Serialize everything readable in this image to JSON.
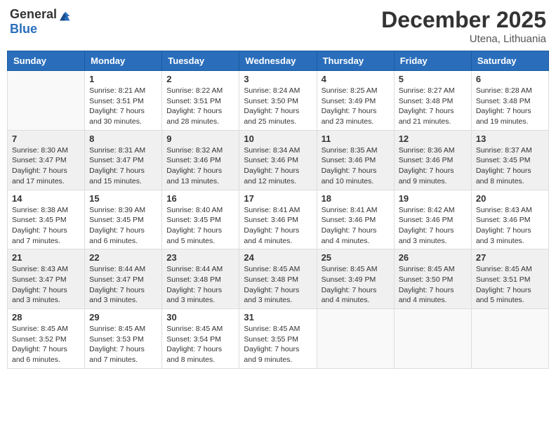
{
  "logo": {
    "general": "General",
    "blue": "Blue"
  },
  "header": {
    "month": "December 2025",
    "location": "Utena, Lithuania"
  },
  "days_of_week": [
    "Sunday",
    "Monday",
    "Tuesday",
    "Wednesday",
    "Thursday",
    "Friday",
    "Saturday"
  ],
  "weeks": [
    {
      "shaded": false,
      "days": [
        {
          "num": "",
          "empty": true
        },
        {
          "num": "1",
          "sunrise": "Sunrise: 8:21 AM",
          "sunset": "Sunset: 3:51 PM",
          "daylight": "Daylight: 7 hours and 30 minutes."
        },
        {
          "num": "2",
          "sunrise": "Sunrise: 8:22 AM",
          "sunset": "Sunset: 3:51 PM",
          "daylight": "Daylight: 7 hours and 28 minutes."
        },
        {
          "num": "3",
          "sunrise": "Sunrise: 8:24 AM",
          "sunset": "Sunset: 3:50 PM",
          "daylight": "Daylight: 7 hours and 25 minutes."
        },
        {
          "num": "4",
          "sunrise": "Sunrise: 8:25 AM",
          "sunset": "Sunset: 3:49 PM",
          "daylight": "Daylight: 7 hours and 23 minutes."
        },
        {
          "num": "5",
          "sunrise": "Sunrise: 8:27 AM",
          "sunset": "Sunset: 3:48 PM",
          "daylight": "Daylight: 7 hours and 21 minutes."
        },
        {
          "num": "6",
          "sunrise": "Sunrise: 8:28 AM",
          "sunset": "Sunset: 3:48 PM",
          "daylight": "Daylight: 7 hours and 19 minutes."
        }
      ]
    },
    {
      "shaded": true,
      "days": [
        {
          "num": "7",
          "sunrise": "Sunrise: 8:30 AM",
          "sunset": "Sunset: 3:47 PM",
          "daylight": "Daylight: 7 hours and 17 minutes."
        },
        {
          "num": "8",
          "sunrise": "Sunrise: 8:31 AM",
          "sunset": "Sunset: 3:47 PM",
          "daylight": "Daylight: 7 hours and 15 minutes."
        },
        {
          "num": "9",
          "sunrise": "Sunrise: 8:32 AM",
          "sunset": "Sunset: 3:46 PM",
          "daylight": "Daylight: 7 hours and 13 minutes."
        },
        {
          "num": "10",
          "sunrise": "Sunrise: 8:34 AM",
          "sunset": "Sunset: 3:46 PM",
          "daylight": "Daylight: 7 hours and 12 minutes."
        },
        {
          "num": "11",
          "sunrise": "Sunrise: 8:35 AM",
          "sunset": "Sunset: 3:46 PM",
          "daylight": "Daylight: 7 hours and 10 minutes."
        },
        {
          "num": "12",
          "sunrise": "Sunrise: 8:36 AM",
          "sunset": "Sunset: 3:46 PM",
          "daylight": "Daylight: 7 hours and 9 minutes."
        },
        {
          "num": "13",
          "sunrise": "Sunrise: 8:37 AM",
          "sunset": "Sunset: 3:45 PM",
          "daylight": "Daylight: 7 hours and 8 minutes."
        }
      ]
    },
    {
      "shaded": false,
      "days": [
        {
          "num": "14",
          "sunrise": "Sunrise: 8:38 AM",
          "sunset": "Sunset: 3:45 PM",
          "daylight": "Daylight: 7 hours and 7 minutes."
        },
        {
          "num": "15",
          "sunrise": "Sunrise: 8:39 AM",
          "sunset": "Sunset: 3:45 PM",
          "daylight": "Daylight: 7 hours and 6 minutes."
        },
        {
          "num": "16",
          "sunrise": "Sunrise: 8:40 AM",
          "sunset": "Sunset: 3:45 PM",
          "daylight": "Daylight: 7 hours and 5 minutes."
        },
        {
          "num": "17",
          "sunrise": "Sunrise: 8:41 AM",
          "sunset": "Sunset: 3:46 PM",
          "daylight": "Daylight: 7 hours and 4 minutes."
        },
        {
          "num": "18",
          "sunrise": "Sunrise: 8:41 AM",
          "sunset": "Sunset: 3:46 PM",
          "daylight": "Daylight: 7 hours and 4 minutes."
        },
        {
          "num": "19",
          "sunrise": "Sunrise: 8:42 AM",
          "sunset": "Sunset: 3:46 PM",
          "daylight": "Daylight: 7 hours and 3 minutes."
        },
        {
          "num": "20",
          "sunrise": "Sunrise: 8:43 AM",
          "sunset": "Sunset: 3:46 PM",
          "daylight": "Daylight: 7 hours and 3 minutes."
        }
      ]
    },
    {
      "shaded": true,
      "days": [
        {
          "num": "21",
          "sunrise": "Sunrise: 8:43 AM",
          "sunset": "Sunset: 3:47 PM",
          "daylight": "Daylight: 7 hours and 3 minutes."
        },
        {
          "num": "22",
          "sunrise": "Sunrise: 8:44 AM",
          "sunset": "Sunset: 3:47 PM",
          "daylight": "Daylight: 7 hours and 3 minutes."
        },
        {
          "num": "23",
          "sunrise": "Sunrise: 8:44 AM",
          "sunset": "Sunset: 3:48 PM",
          "daylight": "Daylight: 7 hours and 3 minutes."
        },
        {
          "num": "24",
          "sunrise": "Sunrise: 8:45 AM",
          "sunset": "Sunset: 3:48 PM",
          "daylight": "Daylight: 7 hours and 3 minutes."
        },
        {
          "num": "25",
          "sunrise": "Sunrise: 8:45 AM",
          "sunset": "Sunset: 3:49 PM",
          "daylight": "Daylight: 7 hours and 4 minutes."
        },
        {
          "num": "26",
          "sunrise": "Sunrise: 8:45 AM",
          "sunset": "Sunset: 3:50 PM",
          "daylight": "Daylight: 7 hours and 4 minutes."
        },
        {
          "num": "27",
          "sunrise": "Sunrise: 8:45 AM",
          "sunset": "Sunset: 3:51 PM",
          "daylight": "Daylight: 7 hours and 5 minutes."
        }
      ]
    },
    {
      "shaded": false,
      "days": [
        {
          "num": "28",
          "sunrise": "Sunrise: 8:45 AM",
          "sunset": "Sunset: 3:52 PM",
          "daylight": "Daylight: 7 hours and 6 minutes."
        },
        {
          "num": "29",
          "sunrise": "Sunrise: 8:45 AM",
          "sunset": "Sunset: 3:53 PM",
          "daylight": "Daylight: 7 hours and 7 minutes."
        },
        {
          "num": "30",
          "sunrise": "Sunrise: 8:45 AM",
          "sunset": "Sunset: 3:54 PM",
          "daylight": "Daylight: 7 hours and 8 minutes."
        },
        {
          "num": "31",
          "sunrise": "Sunrise: 8:45 AM",
          "sunset": "Sunset: 3:55 PM",
          "daylight": "Daylight: 7 hours and 9 minutes."
        },
        {
          "num": "",
          "empty": true
        },
        {
          "num": "",
          "empty": true
        },
        {
          "num": "",
          "empty": true
        }
      ]
    }
  ]
}
